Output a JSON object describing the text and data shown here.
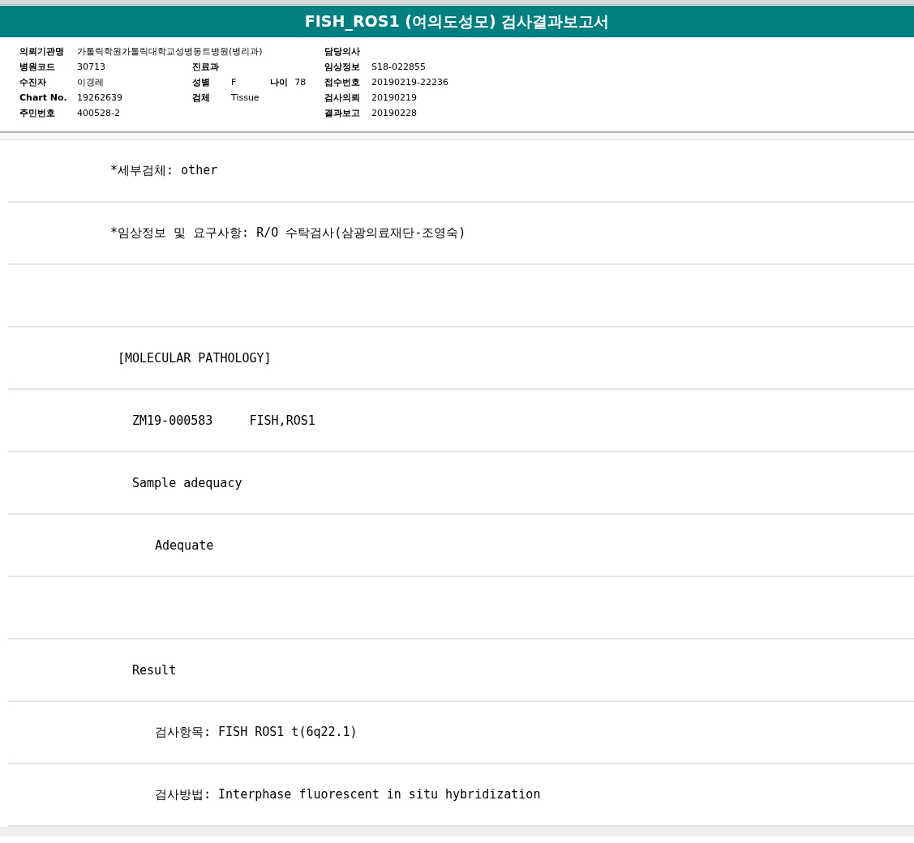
{
  "report_title": "FISH_ROS1 (여의도성모) 검사결과보고서",
  "info_rows": [
    {
      "left": {
        "label": "의뢰기관명",
        "value": "가톨릭학원가톨릭대학교성병동트병원(병리과)"
      },
      "right": {
        "label": "담당의사"
      }
    },
    {
      "left": {
        "label": "병원코드",
        "value": "30713"
      },
      "middle": {
        "label": "진료과"
      },
      "right": {
        "label": "임상정보",
        "value": "S18-022855"
      }
    },
    {
      "left": {
        "label": "수진자",
        "value": "이경레"
      },
      "middle": {
        "label": "성별",
        "value": "F",
        "extra_label": "나이",
        "extra_value": "78"
      },
      "right": {
        "label": "접수번호",
        "value": "20190219-22236"
      }
    },
    {
      "left": {
        "label": "Chart No.",
        "value": "19262639"
      },
      "middle": {
        "label": "검체",
        "value": "Tissue"
      },
      "right": {
        "label": "검사의뢰",
        "value": "20190219"
      }
    },
    {
      "left": {
        "label": "주민번호",
        "value": "400528-2"
      },
      "right": {
        "label": "결과보고",
        "value": "20190228"
      }
    }
  ],
  "lines": [
    {
      "kind": "note",
      "text": "*세부검체: other"
    },
    {
      "kind": "note",
      "text": "*임상정보 및 요구사항: R/O 수탁검사(삼광의료재단-조영숙)"
    },
    {
      "kind": "blank"
    },
    {
      "kind": "section",
      "text": "[MOLECULAR PATHOLOGY]"
    },
    {
      "kind": "item",
      "text": "ZM19-000583     FISH,ROS1"
    },
    {
      "kind": "item",
      "text": "Sample adequacy"
    },
    {
      "kind": "subitem",
      "text": "Adequate"
    },
    {
      "kind": "blank"
    },
    {
      "kind": "item",
      "text": "Result"
    },
    {
      "kind": "subitem",
      "text": "검사항목: FISH ROS1 t(6q22.1)"
    },
    {
      "kind": "subitem",
      "text": "검사방법: Interphase fluorescent in situ hybridization"
    }
  ]
}
